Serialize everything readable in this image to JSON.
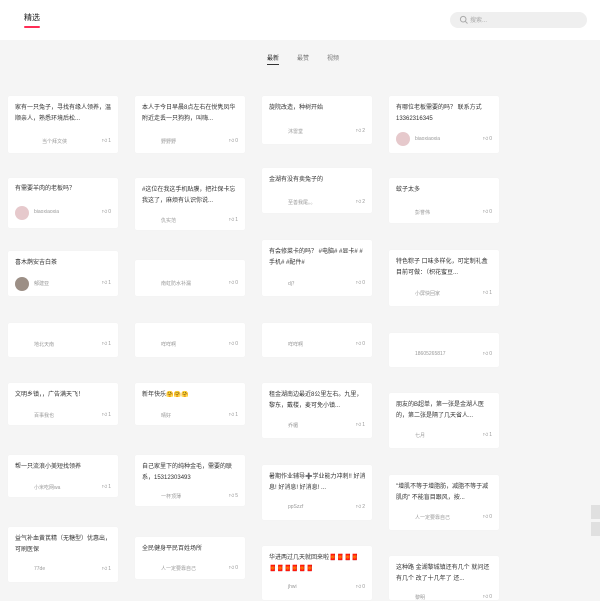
{
  "header": {
    "brand": "精选",
    "search_placeholder": "搜索..."
  },
  "tabs": [
    {
      "label": "最新"
    },
    {
      "label": "最赞"
    },
    {
      "label": "视频"
    }
  ],
  "cards": [
    {
      "title": "家有一只兔子，寻找有缘人领养，温顺亲人，熟悉环境后松...",
      "author": "当个拜文侠",
      "likes": "1"
    },
    {
      "title": "本人于今日早晨8点左右在悦隽凤华附近走丢一只狗狗，叫嗨...",
      "author": "野野野",
      "likes": "0"
    },
    {
      "title": "旋院改造，种树开始",
      "author": "沐雷堂",
      "likes": "2"
    },
    {
      "title": "有哪位老板需要的吗？ 联系方式13362316345",
      "author": "biaoxiaoxia",
      "likes": "0"
    },
    {
      "title": "有需要羊肉的老板吗？",
      "author": "biaoxiaoxia",
      "likes": "0"
    },
    {
      "title": "#这位在我这手机贴膜，把社保卡忘我这了，麻烦有认识你说...",
      "author": "仇实范",
      "likes": "1"
    },
    {
      "title": "金湖有没有卖兔子的",
      "author": "至善我尾。。",
      "likes": "2"
    },
    {
      "title": "蚊子太多",
      "author": "彭誉伟",
      "likes": "0"
    },
    {
      "title": "喜木鹊安吉白茶",
      "author": "郁建亚",
      "likes": "1"
    },
    {
      "title": "",
      "author": "南虹防水补漏",
      "likes": "0"
    },
    {
      "title": "有会修菜卡的吗？ #电脑# #显卡# #手机# #配件#",
      "author": "dj？",
      "likes": "0"
    },
    {
      "title": "特色粽子 口味多样化，可定制礼盒 目前可做：（枳花蜜豆...",
      "author": "小屏快回家",
      "likes": "1"
    },
    {
      "title": "",
      "author": "地北天南",
      "likes": "1"
    },
    {
      "title": "",
      "author": "咩咩啊",
      "likes": "0"
    },
    {
      "title": "",
      "author": "咩咩啊",
      "likes": "0"
    },
    {
      "title": "",
      "author": "18605265817",
      "likes": "0"
    },
    {
      "title": "文明乡镇，，广告满天飞！",
      "author": "百事我也",
      "likes": "1"
    },
    {
      "title": "新年快乐🤗🤗🤗",
      "author": "晴好",
      "likes": "1"
    },
    {
      "title": "租金湖南边最近8公里左右。九里，黎东，戴楼，麦可免小镇...",
      "author": "乔楣",
      "likes": "1"
    },
    {
      "title": "朋友的B超单，第一张是金湖人医的，第二张是隔了几天省人...",
      "author": "七月",
      "likes": "1"
    },
    {
      "title": "帮一只流浪小美短找领养",
      "author": "小米吃网wa",
      "likes": "1"
    },
    {
      "title": "自己家里下的纯种金毛，需要的联系，15312303493",
      "author": "一杯顶薄",
      "likes": "5"
    },
    {
      "title": "暑期作业辅导➕学业能力冲刺!! 好消息! 好消息! 好消息! ...",
      "author": "ppSzzf",
      "likes": "2"
    },
    {
      "title": "\"增肌不等于增脂肪，减脂不等于减肌肉\" 不能盲目跟风，按...",
      "author": "人一定要靠自己",
      "likes": "0"
    },
    {
      "title": "益气补血黄芪精（无糖型）优惠出，可刷医保",
      "author": "77de",
      "likes": "1"
    },
    {
      "title": "全民健身平民百姓场所",
      "author": "人一定要靠自己",
      "likes": "0"
    },
    {
      "title": "华进两过几天就回来啦🧧🧧🧧🧧🧧🧧🧧🧧🧧🧧",
      "author": "jhwi",
      "likes": "0"
    },
    {
      "title": "这种路 金湖黎城镇还有几个 就问还有几个 改了十几年了 还...",
      "author": "黎明",
      "likes": "0"
    }
  ],
  "colors": {
    "accent": "#ff2d55",
    "background": "#f5f5f5"
  }
}
